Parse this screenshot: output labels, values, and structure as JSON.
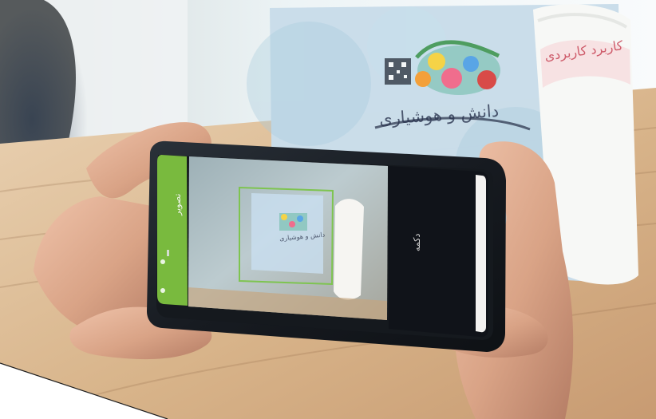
{
  "image": {
    "description_icons": [
      "phone",
      "hand",
      "book",
      "bottle",
      "qr-code"
    ],
    "colors": {
      "sky_wall": "#e6edf0",
      "table_wood": "#d8b993",
      "phone_body": "#1d2228",
      "phone_screen_dark": "#11151a",
      "green_bar": "#79ba3e",
      "skin": "#d7a184",
      "book_blue": "#bad4e3",
      "accent_red": "#d14b59",
      "white_panel": "#f5f4f2"
    }
  },
  "phone": {
    "camera_label": "تصویر",
    "capture_label": "دکمه"
  },
  "book": {
    "title": "دانش و هوشیاری",
    "side_title": "کاربرد کاربردی",
    "small_title": "دانش و هوشیاری"
  }
}
